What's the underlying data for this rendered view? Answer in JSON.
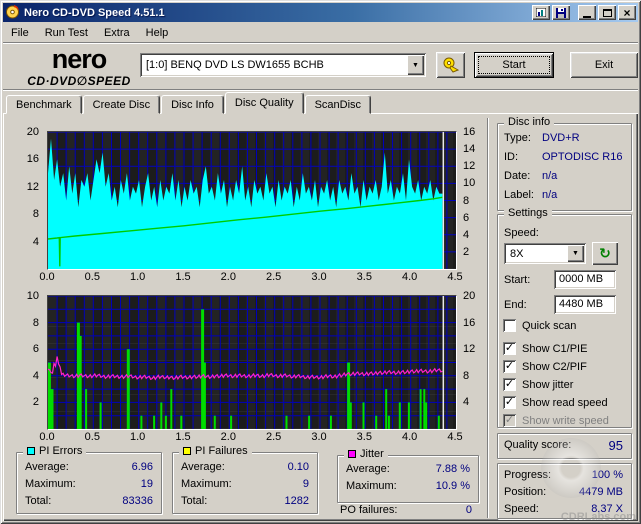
{
  "window": {
    "title": "Nero CD-DVD Speed 4.51.1"
  },
  "icons": {
    "app": "nero-disc",
    "graph_button": "bar-chart",
    "save_button": "floppy-disk",
    "minimize": "minimize",
    "maximize": "maximize",
    "close": "×",
    "drive_options": "hand-with-disc",
    "dropdown_arrow": "▼",
    "refresh": "↻",
    "check": "✓"
  },
  "menu": {
    "items": [
      {
        "label": "File"
      },
      {
        "label": "Run Test"
      },
      {
        "label": "Extra"
      },
      {
        "label": "Help"
      }
    ]
  },
  "header": {
    "logo_line1": "nero",
    "logo_line2": "CD·DVD∅SPEED",
    "drive_selector": "[1:0]   BENQ DVD LS DW1655 BCHB",
    "start_label": "Start",
    "exit_label": "Exit"
  },
  "tabs": [
    {
      "label": "Benchmark",
      "active": false
    },
    {
      "label": "Create Disc",
      "active": false
    },
    {
      "label": "Disc Info",
      "active": false
    },
    {
      "label": "Disc Quality",
      "active": true
    },
    {
      "label": "ScanDisc",
      "active": false
    }
  ],
  "disc_info": {
    "title": "Disc info",
    "rows": [
      {
        "label": "Type:",
        "value": "DVD+R"
      },
      {
        "label": "ID:",
        "value": "OPTODISC R16"
      },
      {
        "label": "Date:",
        "value": "n/a"
      },
      {
        "label": "Label:",
        "value": "n/a"
      }
    ]
  },
  "settings": {
    "title": "Settings",
    "speed_label": "Speed:",
    "speed_value": "8X",
    "fields": [
      {
        "label": "Start:",
        "value": "0000 MB"
      },
      {
        "label": "End:",
        "value": "4480 MB"
      }
    ],
    "checkboxes": [
      {
        "label": "Quick scan",
        "checked": false,
        "disabled": false
      },
      {
        "label": "Show C1/PIE",
        "checked": true,
        "disabled": false
      },
      {
        "label": "Show C2/PIF",
        "checked": true,
        "disabled": false
      },
      {
        "label": "Show jitter",
        "checked": true,
        "disabled": false
      },
      {
        "label": "Show read speed",
        "checked": true,
        "disabled": false
      },
      {
        "label": "Show write speed",
        "checked": true,
        "disabled": true
      }
    ]
  },
  "quality": {
    "label": "Quality score:",
    "value": "95"
  },
  "progress": {
    "rows": [
      {
        "label": "Progress:",
        "value": "100 %"
      },
      {
        "label": "Position:",
        "value": "4479 MB"
      },
      {
        "label": "Speed:",
        "value": "8.37 X"
      }
    ]
  },
  "stats": {
    "groups": [
      {
        "title": "PI Errors",
        "legend_color": "#00ffff",
        "rows": [
          {
            "label": "Average:",
            "value": "6.96"
          },
          {
            "label": "Maximum:",
            "value": "19"
          },
          {
            "label": "Total:",
            "value": "83336"
          }
        ]
      },
      {
        "title": "PI Failures",
        "legend_color": "#ffff00",
        "rows": [
          {
            "label": "Average:",
            "value": "0.10"
          },
          {
            "label": "Maximum:",
            "value": "9"
          },
          {
            "label": "Total:",
            "value": "1282"
          }
        ]
      },
      {
        "title": "Jitter",
        "legend_color": "#ff00ff",
        "rows": [
          {
            "label": "Average:",
            "value": "7.88 %"
          },
          {
            "label": "Maximum:",
            "value": "10.9 %"
          }
        ]
      }
    ],
    "po_label": "PO failures:",
    "po_value": "0"
  },
  "watermark": "CDRLabs.com",
  "colors": {
    "value_text": "#000080",
    "chrome": "#d4d0c8",
    "title_gradient_start": "#0a246a",
    "title_gradient_end": "#a6caf0",
    "pie_fill": "#00ffff",
    "pif_spikes": "#00dd00",
    "jitter_line": "#ff22cc",
    "read_speed_line": "#00cc00",
    "grid": "#0000bb",
    "chart_bg": "#1c1c1c"
  },
  "chart_data": [
    {
      "type": "area",
      "name": "PI Errors vs disc position (GB)",
      "x_axis": {
        "max": 4.5,
        "ticks": [
          0,
          0.5,
          1,
          1.5,
          2,
          2.5,
          3,
          3.5,
          4,
          4.5
        ]
      },
      "left_axis": {
        "max": 20,
        "ticks": [
          4,
          8,
          12,
          16,
          20
        ]
      },
      "right_axis": {
        "max": 16,
        "ticks": [
          2,
          4,
          6,
          8,
          10,
          12,
          14,
          16
        ]
      },
      "grid": {
        "x_step": 0.1,
        "y_divisions": 8,
        "color": "#0000bb"
      },
      "end_marker": {
        "x": 4.36,
        "color": "#e8e8e8"
      },
      "series": [
        {
          "name": "PI Errors (C1/PIE)",
          "type": "area",
          "axis": "left",
          "color": "#00ffff",
          "x_end": 4.35,
          "values": [
            14,
            19,
            13,
            16,
            12,
            14,
            10,
            15,
            11,
            14,
            9,
            13,
            12,
            14,
            10,
            13,
            16,
            14,
            17,
            12,
            14,
            10,
            12,
            9,
            13,
            11,
            14,
            10,
            12,
            11,
            13,
            9,
            12,
            14,
            10,
            12,
            9,
            13,
            10,
            12,
            11,
            14,
            10,
            13,
            9,
            12,
            10,
            13,
            11,
            12,
            9,
            13,
            15,
            11,
            12,
            10,
            14,
            11,
            13,
            9,
            12,
            10,
            13,
            11,
            15,
            10,
            12,
            9,
            13,
            11,
            12,
            10,
            14,
            11,
            12,
            9,
            13,
            10,
            12,
            11,
            13,
            9,
            12,
            10,
            14,
            11,
            12,
            10,
            13,
            9,
            12,
            11,
            13,
            10,
            12,
            9,
            13,
            11,
            12,
            10,
            14,
            11,
            12,
            9,
            13,
            10,
            12,
            11,
            13,
            10,
            12,
            17,
            11,
            13,
            10,
            12,
            11,
            14,
            10,
            16,
            12,
            11,
            13,
            10,
            12,
            11,
            13,
            10,
            12,
            11,
            11
          ]
        },
        {
          "name": "Read speed (X)",
          "type": "line",
          "axis": "right",
          "color": "#00cc00",
          "points": [
            [
              0,
              3.5
            ],
            [
              0.1,
              3.62
            ],
            [
              0.125,
              3.66
            ],
            [
              0.13,
              0.3
            ],
            [
              0.135,
              3.67
            ],
            [
              0.3,
              3.85
            ],
            [
              0.6,
              4.15
            ],
            [
              0.9,
              4.45
            ],
            [
              1.2,
              4.75
            ],
            [
              1.5,
              5.05
            ],
            [
              1.8,
              5.4
            ],
            [
              2.1,
              5.75
            ],
            [
              2.4,
              6.05
            ],
            [
              2.7,
              6.4
            ],
            [
              3.0,
              6.75
            ],
            [
              3.3,
              7.05
            ],
            [
              3.6,
              7.4
            ],
            [
              3.9,
              7.75
            ],
            [
              4.1,
              8.0
            ],
            [
              4.25,
              8.2
            ],
            [
              4.35,
              8.37
            ]
          ]
        }
      ]
    },
    {
      "type": "spikes",
      "name": "PI Failures and Jitter vs disc position (GB)",
      "x_axis": {
        "max": 4.5,
        "ticks": [
          0,
          0.5,
          1,
          1.5,
          2,
          2.5,
          3,
          3.5,
          4,
          4.5
        ]
      },
      "left_axis": {
        "max": 10,
        "ticks": [
          2,
          4,
          6,
          8,
          10
        ]
      },
      "right_axis": {
        "max": 20,
        "ticks": [
          4,
          8,
          12,
          16,
          20
        ]
      },
      "grid": {
        "x_step": 0.1,
        "y_divisions": 10,
        "color": "#0000bb"
      },
      "end_marker": {
        "x": 4.36,
        "color": "#e8e8e8"
      },
      "series": [
        {
          "name": "PI Failures (C2/PIF)",
          "type": "spikes",
          "axis": "left",
          "color": "#00dd00",
          "points": [
            [
              0.01,
              5
            ],
            [
              0.03,
              3
            ],
            [
              0.05,
              3
            ],
            [
              0.33,
              8
            ],
            [
              0.35,
              7
            ],
            [
              0.42,
              3
            ],
            [
              0.58,
              2
            ],
            [
              0.88,
              6
            ],
            [
              1.03,
              1
            ],
            [
              1.17,
              1
            ],
            [
              1.25,
              2
            ],
            [
              1.3,
              1
            ],
            [
              1.36,
              3
            ],
            [
              1.47,
              1
            ],
            [
              1.7,
              9
            ],
            [
              1.72,
              5
            ],
            [
              1.84,
              1
            ],
            [
              2.02,
              1
            ],
            [
              2.63,
              1
            ],
            [
              2.88,
              1
            ],
            [
              3.12,
              1
            ],
            [
              3.31,
              5
            ],
            [
              3.34,
              2
            ],
            [
              3.48,
              2
            ],
            [
              3.62,
              1
            ],
            [
              3.73,
              3
            ],
            [
              3.76,
              1
            ],
            [
              3.88,
              2
            ],
            [
              3.98,
              2
            ],
            [
              4.11,
              3
            ],
            [
              4.15,
              3
            ],
            [
              4.17,
              2
            ],
            [
              4.31,
              1
            ]
          ]
        },
        {
          "name": "Jitter (%)",
          "type": "noisy-line",
          "axis": "right",
          "color": "#ff22cc",
          "x_end": 4.35,
          "fuzz": 0.22,
          "values": [
            9.0,
            8.4,
            10.9,
            8.2,
            8.1,
            8.0,
            7.9,
            8.1,
            8.0,
            7.9,
            8.0,
            8.1,
            7.9,
            7.8,
            8.0,
            7.9,
            7.8,
            7.9,
            8.0,
            7.8,
            7.7,
            7.9,
            7.8,
            7.6,
            7.8,
            7.9,
            7.7,
            7.8,
            7.6,
            7.9,
            7.8,
            7.7,
            7.9,
            7.8,
            8.0,
            7.9,
            7.8,
            8.0,
            7.9,
            8.1,
            8.0,
            7.9,
            8.1,
            8.0,
            7.9,
            8.0,
            8.1,
            7.9,
            8.0,
            8.2,
            8.0,
            7.9,
            8.1,
            8.0,
            7.8,
            8.0,
            7.9,
            7.7,
            7.9,
            7.8,
            7.7,
            7.9,
            8.0,
            7.8,
            8.0,
            8.1,
            8.3,
            8.2,
            8.4,
            8.3,
            8.2,
            8.4,
            8.3,
            8.5,
            8.4,
            8.6,
            8.5,
            8.4,
            8.6,
            8.5,
            8.7,
            8.6,
            8.8,
            8.7,
            8.6,
            8.8,
            8.9,
            8.7
          ]
        }
      ]
    }
  ]
}
